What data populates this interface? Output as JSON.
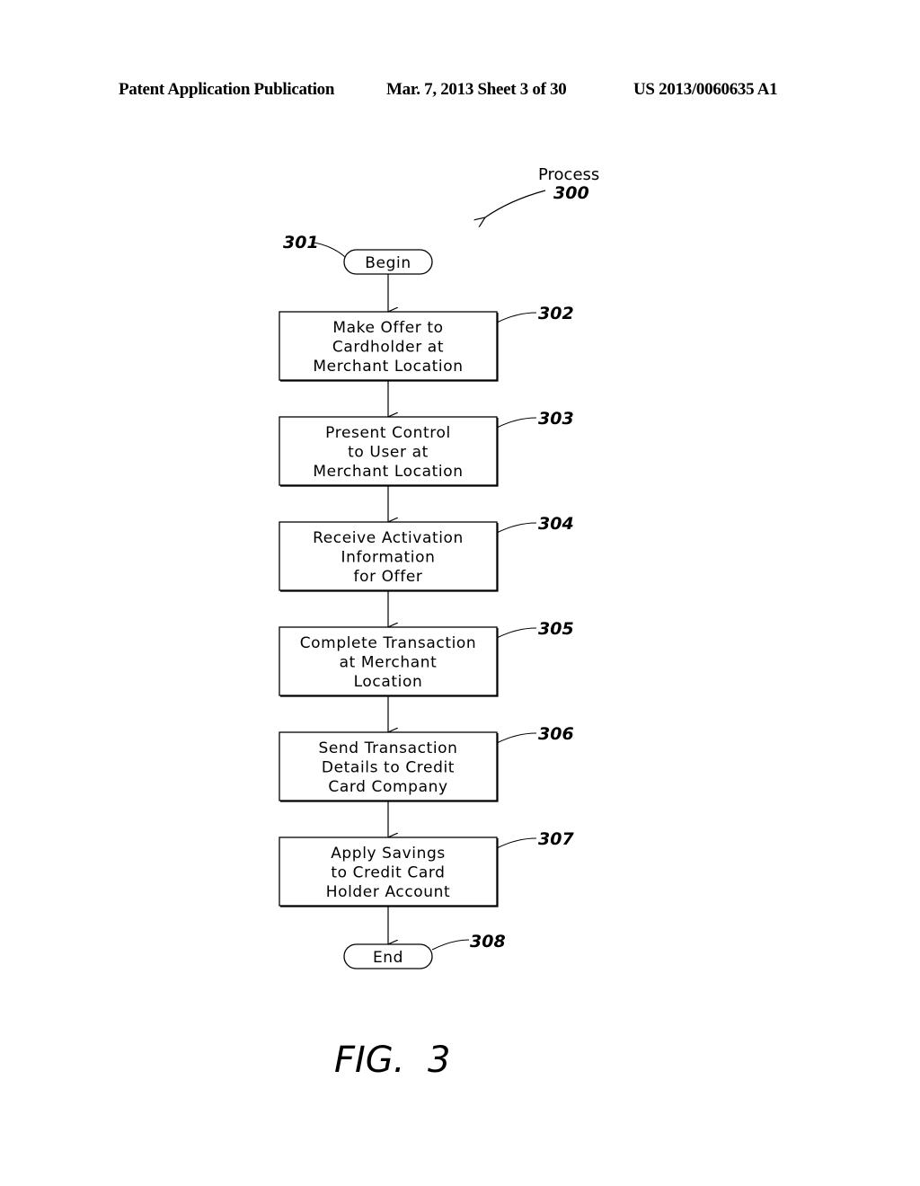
{
  "header": {
    "left": "Patent Application Publication",
    "middle": "Mar. 7, 2013   Sheet 3 of 30",
    "right": "US 2013/0060635 A1"
  },
  "process": {
    "label": "Process",
    "number": "300"
  },
  "start": {
    "ref": "301",
    "label": "Begin"
  },
  "steps": [
    {
      "ref": "302",
      "lines": [
        "Make Offer to",
        "Cardholder at",
        "Merchant Location"
      ]
    },
    {
      "ref": "303",
      "lines": [
        "Present Control",
        "to User at",
        "Merchant Location"
      ]
    },
    {
      "ref": "304",
      "lines": [
        "Receive Activation",
        "Information",
        "for Offer"
      ]
    },
    {
      "ref": "305",
      "lines": [
        "Complete Transaction",
        "at Merchant",
        "Location"
      ]
    },
    {
      "ref": "306",
      "lines": [
        "Send Transaction",
        "Details to Credit",
        "Card Company"
      ]
    },
    {
      "ref": "307",
      "lines": [
        "Apply Savings",
        "to Credit Card",
        "Holder Account"
      ]
    }
  ],
  "end": {
    "ref": "308",
    "label": "End"
  },
  "figure_label": "FIG.  3"
}
